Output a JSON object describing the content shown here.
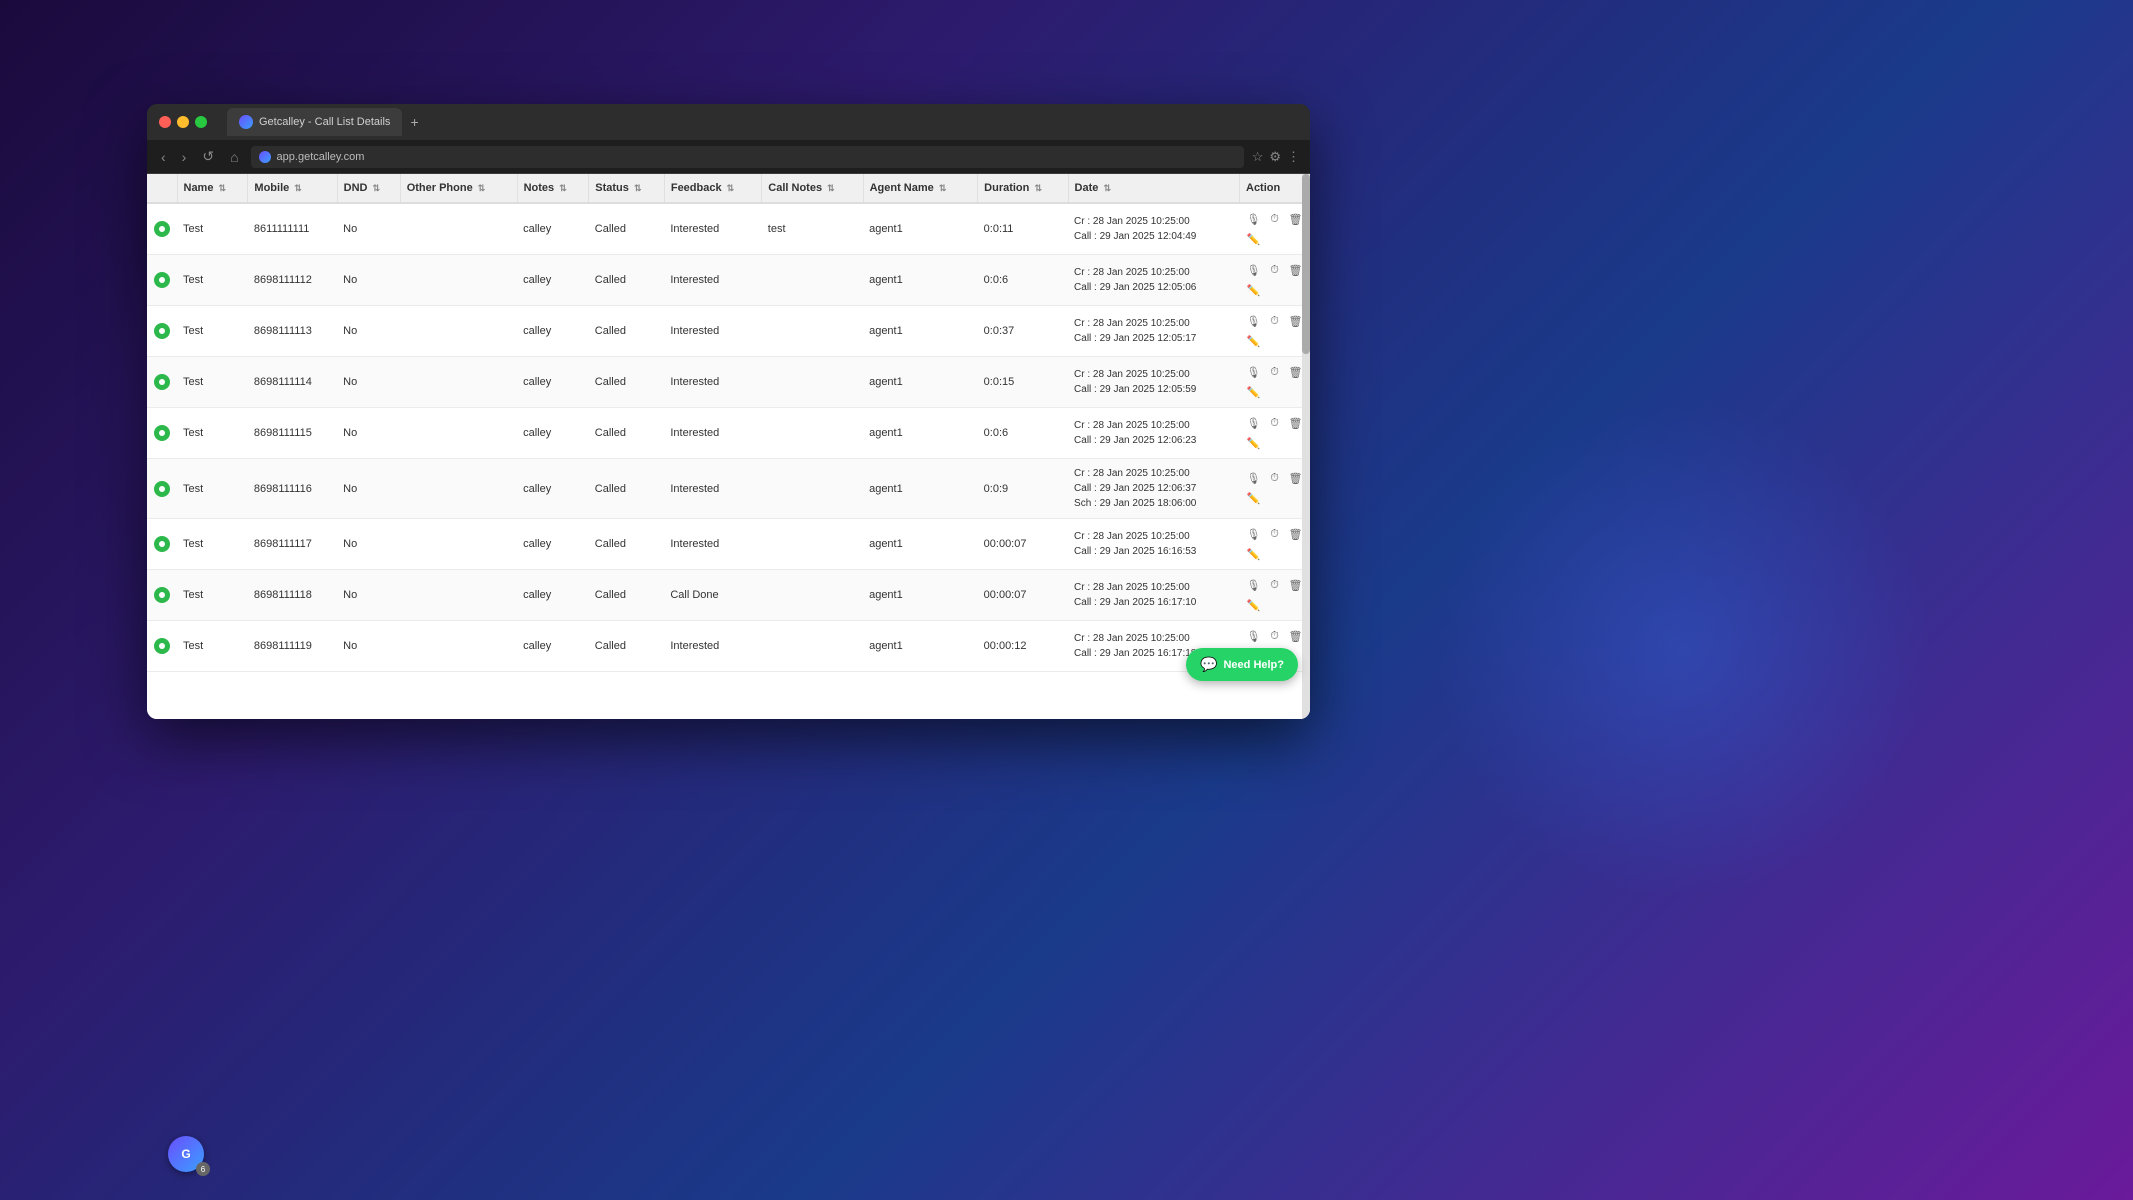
{
  "browser": {
    "title": "Getcalley - Call List Details",
    "url": "app.getcalley.com",
    "tab_plus": "+"
  },
  "nav": {
    "back": "‹",
    "forward": "›",
    "refresh": "↺",
    "home": "⌂"
  },
  "table": {
    "headers": [
      {
        "id": "checkbox",
        "label": ""
      },
      {
        "id": "name",
        "label": "Name"
      },
      {
        "id": "mobile",
        "label": "Mobile"
      },
      {
        "id": "dnd",
        "label": "DND"
      },
      {
        "id": "other_phone",
        "label": "Other Phone"
      },
      {
        "id": "notes",
        "label": "Notes"
      },
      {
        "id": "status",
        "label": "Status"
      },
      {
        "id": "feedback",
        "label": "Feedback"
      },
      {
        "id": "call_notes",
        "label": "Call Notes"
      },
      {
        "id": "agent_name",
        "label": "Agent Name"
      },
      {
        "id": "duration",
        "label": "Duration"
      },
      {
        "id": "date",
        "label": "Date"
      },
      {
        "id": "action",
        "label": "Action"
      }
    ],
    "rows": [
      {
        "id": 1,
        "status_dot": "green",
        "name": "Test",
        "mobile": "8611111111",
        "dnd": "No",
        "other_phone": "",
        "notes": "calley",
        "status": "Called",
        "feedback": "Interested",
        "call_notes": "test",
        "agent_name": "agent1",
        "duration": "0:0:11",
        "cr_date": "Cr : 28 Jan 2025 10:25:00",
        "call_date": "Call : 29 Jan 2025 12:04:49"
      },
      {
        "id": 2,
        "status_dot": "green",
        "name": "Test",
        "mobile": "8698111112",
        "dnd": "No",
        "other_phone": "",
        "notes": "calley",
        "status": "Called",
        "feedback": "Interested",
        "call_notes": "",
        "agent_name": "agent1",
        "duration": "0:0:6",
        "cr_date": "Cr : 28 Jan 2025 10:25:00",
        "call_date": "Call : 29 Jan 2025 12:05:06"
      },
      {
        "id": 3,
        "status_dot": "green",
        "name": "Test",
        "mobile": "8698111113",
        "dnd": "No",
        "other_phone": "",
        "notes": "calley",
        "status": "Called",
        "feedback": "Interested",
        "call_notes": "",
        "agent_name": "agent1",
        "duration": "0:0:37",
        "cr_date": "Cr : 28 Jan 2025 10:25:00",
        "call_date": "Call : 29 Jan 2025 12:05:17"
      },
      {
        "id": 4,
        "status_dot": "green",
        "name": "Test",
        "mobile": "8698111114",
        "dnd": "No",
        "other_phone": "",
        "notes": "calley",
        "status": "Called",
        "feedback": "Interested",
        "call_notes": "",
        "agent_name": "agent1",
        "duration": "0:0:15",
        "cr_date": "Cr : 28 Jan 2025 10:25:00",
        "call_date": "Call : 29 Jan 2025 12:05:59"
      },
      {
        "id": 5,
        "status_dot": "green",
        "name": "Test",
        "mobile": "8698111115",
        "dnd": "No",
        "other_phone": "",
        "notes": "calley",
        "status": "Called",
        "feedback": "Interested",
        "call_notes": "",
        "agent_name": "agent1",
        "duration": "0:0:6",
        "cr_date": "Cr : 28 Jan 2025 10:25:00",
        "call_date": "Call : 29 Jan 2025 12:06:23"
      },
      {
        "id": 6,
        "status_dot": "green",
        "name": "Test",
        "mobile": "8698111116",
        "dnd": "No",
        "other_phone": "",
        "notes": "calley",
        "status": "Called",
        "feedback": "Interested",
        "call_notes": "",
        "agent_name": "agent1",
        "duration": "0:0:9",
        "cr_date": "Cr : 28 Jan 2025 10:25:00",
        "call_date": "Call : 29 Jan 2025 12:06:37",
        "sch_date": "Sch : 29 Jan 2025 18:06:00"
      },
      {
        "id": 7,
        "status_dot": "green",
        "name": "Test",
        "mobile": "8698111117",
        "dnd": "No",
        "other_phone": "",
        "notes": "calley",
        "status": "Called",
        "feedback": "Interested",
        "call_notes": "",
        "agent_name": "agent1",
        "duration": "00:00:07",
        "cr_date": "Cr : 28 Jan 2025 10:25:00",
        "call_date": "Call : 29 Jan 2025 16:16:53"
      },
      {
        "id": 8,
        "status_dot": "green",
        "name": "Test",
        "mobile": "8698111118",
        "dnd": "No",
        "other_phone": "",
        "notes": "calley",
        "status": "Called",
        "feedback": "Call Done",
        "call_notes": "",
        "agent_name": "agent1",
        "duration": "00:00:07",
        "cr_date": "Cr : 28 Jan 2025 10:25:00",
        "call_date": "Call : 29 Jan 2025 16:17:10"
      },
      {
        "id": 9,
        "status_dot": "green",
        "name": "Test",
        "mobile": "8698111119",
        "dnd": "No",
        "other_phone": "",
        "notes": "calley",
        "status": "Called",
        "feedback": "Interested",
        "call_notes": "",
        "agent_name": "agent1",
        "duration": "00:00:12",
        "cr_date": "Cr : 28 Jan 2025 10:25:00",
        "call_date": "Call : 29 Jan 2025 16:17:18"
      }
    ]
  },
  "need_help": {
    "label": "Need Help?",
    "icon": "💬"
  },
  "notification_count": "6"
}
